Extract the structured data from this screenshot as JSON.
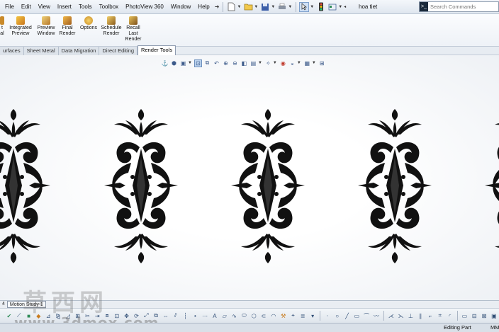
{
  "menubar": {
    "items": [
      "File",
      "Edit",
      "View",
      "Insert",
      "Tools",
      "Toolbox",
      "PhotoView 360",
      "Window",
      "Help"
    ],
    "toolbar_icons": [
      "new-document-icon",
      "open-folder-icon",
      "save-icon",
      "print-icon",
      "select-arrow-icon",
      "rebuild-icon",
      "options-icon"
    ]
  },
  "window_title": "hoa tiet",
  "search": {
    "placeholder": "Search Commands"
  },
  "ribbon": {
    "buttons": [
      {
        "lines": [
          "t",
          "al"
        ],
        "icon": "final-render-partial-icon"
      },
      {
        "lines": [
          "Integrated",
          "Preview"
        ],
        "icon": "integrated-preview-icon"
      },
      {
        "lines": [
          "Preview",
          "Window"
        ],
        "icon": "preview-window-icon"
      },
      {
        "lines": [
          "Final",
          "Render"
        ],
        "icon": "final-render-icon"
      },
      {
        "lines": [
          "Options"
        ],
        "icon": "options-icon"
      },
      {
        "lines": [
          "Schedule",
          "Render"
        ],
        "icon": "schedule-render-icon"
      },
      {
        "lines": [
          "Recall",
          "Last",
          "Render"
        ],
        "icon": "recall-render-icon"
      }
    ]
  },
  "tabs": [
    "urfaces",
    "Sheet Metal",
    "Data Migration",
    "Direct Editing",
    "Render Tools"
  ],
  "active_tab": "Render Tools",
  "bottom_tabs": [
    "4",
    "Motion Study 1"
  ],
  "watermark": {
    "text": "草西网",
    "url": "www.3dmox.com"
  },
  "status": {
    "mode": "Editing Part",
    "units": "MM"
  },
  "colors": {
    "accent": "#1e3c6e",
    "ornament": "#111111",
    "selected": "#bcd3ee"
  }
}
